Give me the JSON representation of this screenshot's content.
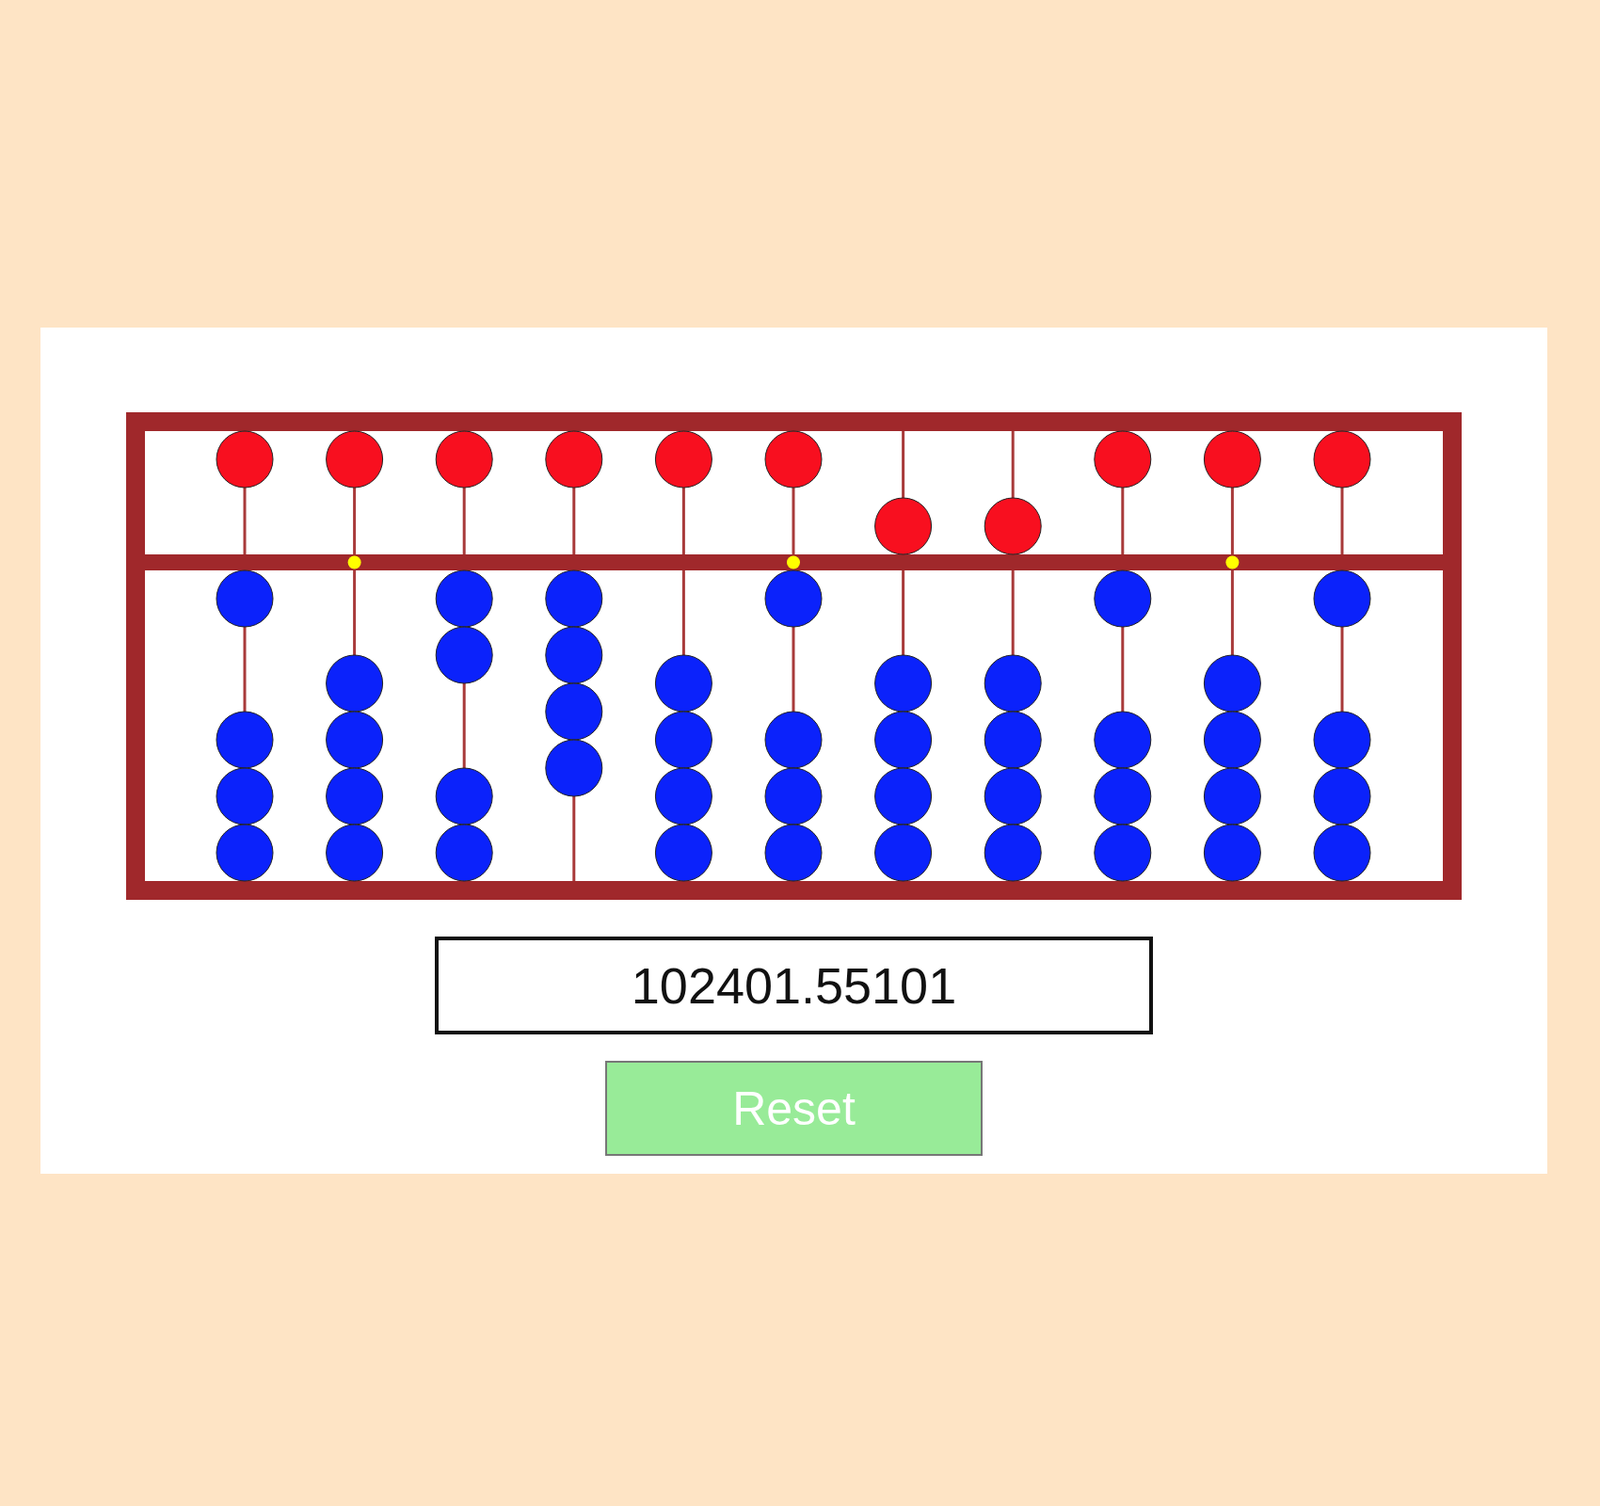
{
  "abacus": {
    "rods": [
      {
        "upper_bead_down": false,
        "lower_beads_up": 1,
        "marker": false
      },
      {
        "upper_bead_down": false,
        "lower_beads_up": 0,
        "marker": true
      },
      {
        "upper_bead_down": false,
        "lower_beads_up": 2,
        "marker": false
      },
      {
        "upper_bead_down": false,
        "lower_beads_up": 4,
        "marker": false
      },
      {
        "upper_bead_down": false,
        "lower_beads_up": 0,
        "marker": false
      },
      {
        "upper_bead_down": false,
        "lower_beads_up": 1,
        "marker": true
      },
      {
        "upper_bead_down": true,
        "lower_beads_up": 0,
        "marker": false
      },
      {
        "upper_bead_down": true,
        "lower_beads_up": 0,
        "marker": false
      },
      {
        "upper_bead_down": false,
        "lower_beads_up": 1,
        "marker": false
      },
      {
        "upper_bead_down": false,
        "lower_beads_up": 0,
        "marker": true
      },
      {
        "upper_bead_down": false,
        "lower_beads_up": 1,
        "marker": false
      }
    ]
  },
  "display": {
    "value": "102401.55101"
  },
  "button": {
    "label": "Reset"
  }
}
